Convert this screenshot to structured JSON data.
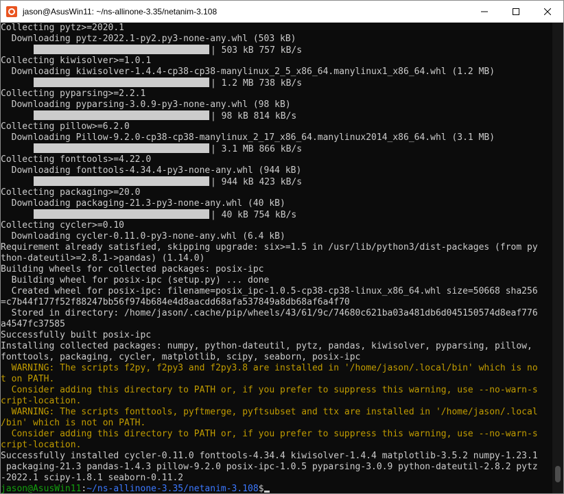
{
  "window": {
    "title": "jason@AsusWin11: ~/ns-allinone-3.35/netanim-3.108",
    "icon": "ubuntu-icon",
    "controls": [
      "minimize",
      "maximize",
      "close"
    ]
  },
  "colors": {
    "background": "#0c0c0c",
    "text": "#cccccc",
    "warning": "#c19c00",
    "prompt_user": "#13a10e",
    "prompt_path": "#3b78ff"
  },
  "terminal": {
    "lines": [
      {
        "type": "text",
        "text": "Collecting pytz>=2020.1"
      },
      {
        "type": "text",
        "text": "  Downloading pytz-2022.1-py2.py3-none-any.whl (503 kB)"
      },
      {
        "type": "progress",
        "text": "| 503 kB 757 kB/s"
      },
      {
        "type": "text",
        "text": "Collecting kiwisolver>=1.0.1"
      },
      {
        "type": "text",
        "text": "  Downloading kiwisolver-1.4.4-cp38-cp38-manylinux_2_5_x86_64.manylinux1_x86_64.whl (1.2 MB)"
      },
      {
        "type": "progress",
        "text": "| 1.2 MB 738 kB/s"
      },
      {
        "type": "text",
        "text": "Collecting pyparsing>=2.2.1"
      },
      {
        "type": "text",
        "text": "  Downloading pyparsing-3.0.9-py3-none-any.whl (98 kB)"
      },
      {
        "type": "progress",
        "text": "| 98 kB 814 kB/s"
      },
      {
        "type": "text",
        "text": "Collecting pillow>=6.2.0"
      },
      {
        "type": "text",
        "text": "  Downloading Pillow-9.2.0-cp38-cp38-manylinux_2_17_x86_64.manylinux2014_x86_64.whl (3.1 MB)"
      },
      {
        "type": "progress",
        "text": "| 3.1 MB 866 kB/s"
      },
      {
        "type": "text",
        "text": "Collecting fonttools>=4.22.0"
      },
      {
        "type": "text",
        "text": "  Downloading fonttools-4.34.4-py3-none-any.whl (944 kB)"
      },
      {
        "type": "progress",
        "text": "| 944 kB 423 kB/s"
      },
      {
        "type": "text",
        "text": "Collecting packaging>=20.0"
      },
      {
        "type": "text",
        "text": "  Downloading packaging-21.3-py3-none-any.whl (40 kB)"
      },
      {
        "type": "progress",
        "text": "| 40 kB 754 kB/s"
      },
      {
        "type": "text",
        "text": "Collecting cycler>=0.10"
      },
      {
        "type": "text",
        "text": "  Downloading cycler-0.11.0-py3-none-any.whl (6.4 kB)"
      },
      {
        "type": "text",
        "text": "Requirement already satisfied, skipping upgrade: six>=1.5 in /usr/lib/python3/dist-packages (from py"
      },
      {
        "type": "text",
        "text": "thon-dateutil>=2.8.1->pandas) (1.14.0)"
      },
      {
        "type": "text",
        "text": "Building wheels for collected packages: posix-ipc"
      },
      {
        "type": "text",
        "text": "  Building wheel for posix-ipc (setup.py) ... done"
      },
      {
        "type": "text",
        "text": "  Created wheel for posix-ipc: filename=posix_ipc-1.0.5-cp38-cp38-linux_x86_64.whl size=50668 sha256"
      },
      {
        "type": "text",
        "text": "=c7b44f177f52f88247bb56f974b684e4d8aacdd68afa537849a8db68af6a4f70"
      },
      {
        "type": "text",
        "text": "  Stored in directory: /home/jason/.cache/pip/wheels/43/61/9c/74680c621ba03a481db6d045150574d8eaf776"
      },
      {
        "type": "text",
        "text": "a4547fc37585"
      },
      {
        "type": "text",
        "text": "Successfully built posix-ipc"
      },
      {
        "type": "text",
        "text": "Installing collected packages: numpy, python-dateutil, pytz, pandas, kiwisolver, pyparsing, pillow,"
      },
      {
        "type": "text",
        "text": "fonttools, packaging, cycler, matplotlib, scipy, seaborn, posix-ipc"
      },
      {
        "type": "warning",
        "text": "  WARNING: The scripts f2py, f2py3 and f2py3.8 are installed in '/home/jason/.local/bin' which is no"
      },
      {
        "type": "warning",
        "text": "t on PATH."
      },
      {
        "type": "warning",
        "text": "  Consider adding this directory to PATH or, if you prefer to suppress this warning, use --no-warn-s"
      },
      {
        "type": "warning",
        "text": "cript-location."
      },
      {
        "type": "warning",
        "text": "  WARNING: The scripts fonttools, pyftmerge, pyftsubset and ttx are installed in '/home/jason/.local"
      },
      {
        "type": "warning",
        "text": "/bin' which is not on PATH."
      },
      {
        "type": "warning",
        "text": "  Consider adding this directory to PATH or, if you prefer to suppress this warning, use --no-warn-s"
      },
      {
        "type": "warning",
        "text": "cript-location."
      },
      {
        "type": "text",
        "text": "Successfully installed cycler-0.11.0 fonttools-4.34.4 kiwisolver-1.4.4 matplotlib-3.5.2 numpy-1.23.1"
      },
      {
        "type": "text",
        "text": " packaging-21.3 pandas-1.4.3 pillow-9.2.0 posix-ipc-1.0.5 pyparsing-3.0.9 python-dateutil-2.8.2 pytz"
      },
      {
        "type": "text",
        "text": "-2022.1 scipy-1.8.1 seaborn-0.11.2"
      }
    ],
    "prompt": {
      "user": "jason@AsusWin11",
      "separator": ":",
      "path": "~/ns-allinone-3.35/netanim-3.108",
      "symbol": "$"
    }
  }
}
